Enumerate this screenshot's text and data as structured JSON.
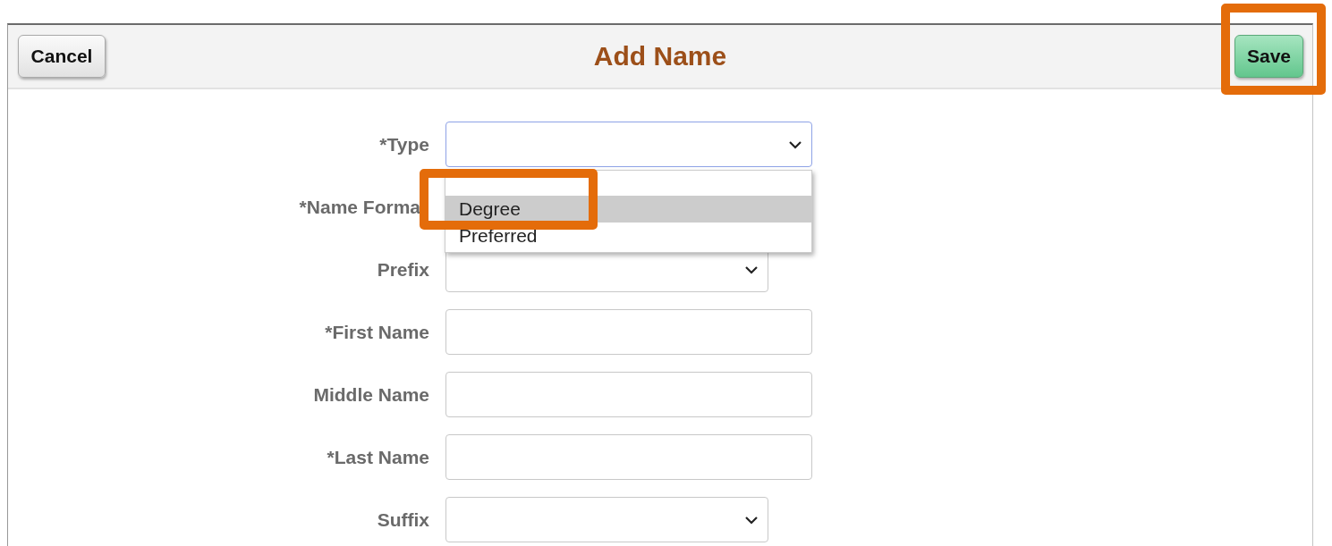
{
  "header": {
    "cancel_button": "Cancel",
    "title": "Add Name",
    "save_button": "Save",
    "save_highlighted": true
  },
  "fields": [
    {
      "label": "*Type",
      "kind": "select"
    },
    {
      "label": "*Name Forma",
      "kind": "covered"
    },
    {
      "label": "Prefix",
      "kind": "short-select"
    },
    {
      "label": "*First Name",
      "kind": "text"
    },
    {
      "label": "Middle Name",
      "kind": "text"
    },
    {
      "label": "*Last Name",
      "kind": "text"
    },
    {
      "label": "Suffix",
      "kind": "short-select"
    }
  ],
  "dropdown": {
    "open": true,
    "highlighted": true,
    "options": [
      {
        "label": "Degree",
        "selected": true
      },
      {
        "label": "Preferred",
        "selected": false
      }
    ]
  }
}
